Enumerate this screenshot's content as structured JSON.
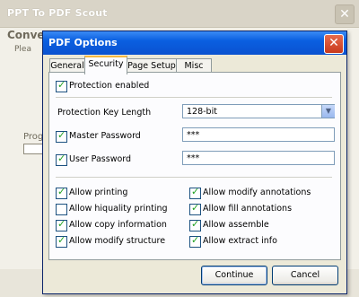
{
  "background_window": {
    "title": "PPT To PDF Scout",
    "close_glyph": "✕",
    "convert_label": "Conve",
    "sub_label": "Plea",
    "progress_label": "Prog"
  },
  "dialog": {
    "title": "PDF Options",
    "close_glyph": "✕",
    "tabs": [
      {
        "label": "General"
      },
      {
        "label": "Security"
      },
      {
        "label": "Page Setup"
      },
      {
        "label": "Misc"
      }
    ],
    "active_tab": "Security",
    "security": {
      "protection_enabled": {
        "label": "Protection enabled",
        "checked": true
      },
      "key_length": {
        "label": "Protection Key Length",
        "value": "128-bit"
      },
      "master_password": {
        "label": "Master Password",
        "checked": true,
        "value": "***"
      },
      "user_password": {
        "label": "User Password",
        "checked": true,
        "value": "***"
      },
      "permissions": [
        {
          "label": "Allow printing",
          "checked": true
        },
        {
          "label": "Allow modify annotations",
          "checked": true
        },
        {
          "label": "Allow hiquality printing",
          "checked": false
        },
        {
          "label": "Allow fill annotations",
          "checked": true
        },
        {
          "label": "Allow copy information",
          "checked": true
        },
        {
          "label": "Allow assemble",
          "checked": true
        },
        {
          "label": "Allow modify structure",
          "checked": true
        },
        {
          "label": "Allow extract info",
          "checked": true
        }
      ]
    },
    "buttons": {
      "continue": "Continue",
      "cancel": "Cancel"
    }
  },
  "colors": {
    "titlebar_blue": "#0a5fe0",
    "close_red": "#c8391c",
    "check_green": "#21a121"
  }
}
